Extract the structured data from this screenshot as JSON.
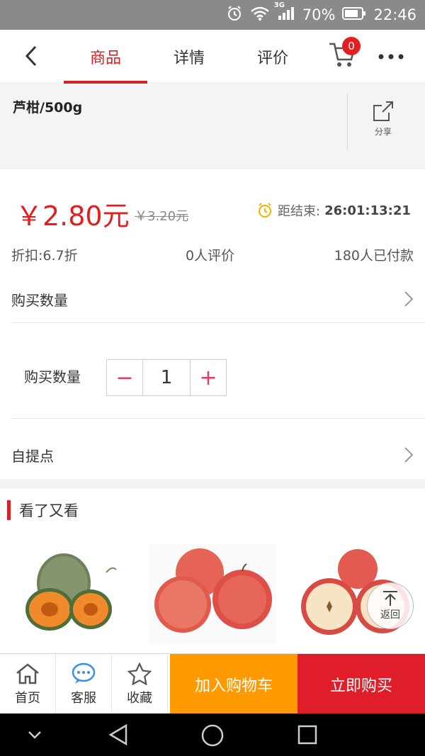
{
  "status_bar": {
    "network": "3G",
    "battery": "70%",
    "time": "22:46"
  },
  "nav": {
    "tabs": [
      "商品",
      "详情",
      "评价"
    ],
    "active_tab": "商品",
    "cart_count": "0"
  },
  "product": {
    "title": "芦柑/500g",
    "share_label": "分享",
    "price": "￥2.80元",
    "original_price": "￥3.20元",
    "countdown_label": "距结束:",
    "countdown_time": "26:01:13:21",
    "discount": "折扣:6.7折",
    "reviews": "0人评价",
    "paid": "180人已付款"
  },
  "rows": {
    "qty_row_label": "购买数量",
    "pickup_label": "自提点"
  },
  "quantity": {
    "label": "购买数量",
    "value": "1",
    "minus": "−",
    "plus": "+"
  },
  "recommend": {
    "title": "看了又看",
    "back_top_label": "返回"
  },
  "bottom_bar": {
    "home": "首页",
    "service": "客服",
    "favorite": "收藏",
    "add_to_cart": "加入购物车",
    "buy_now": "立即购买"
  },
  "colors": {
    "brand_red": "#e02020",
    "orange": "#ff9a00"
  }
}
